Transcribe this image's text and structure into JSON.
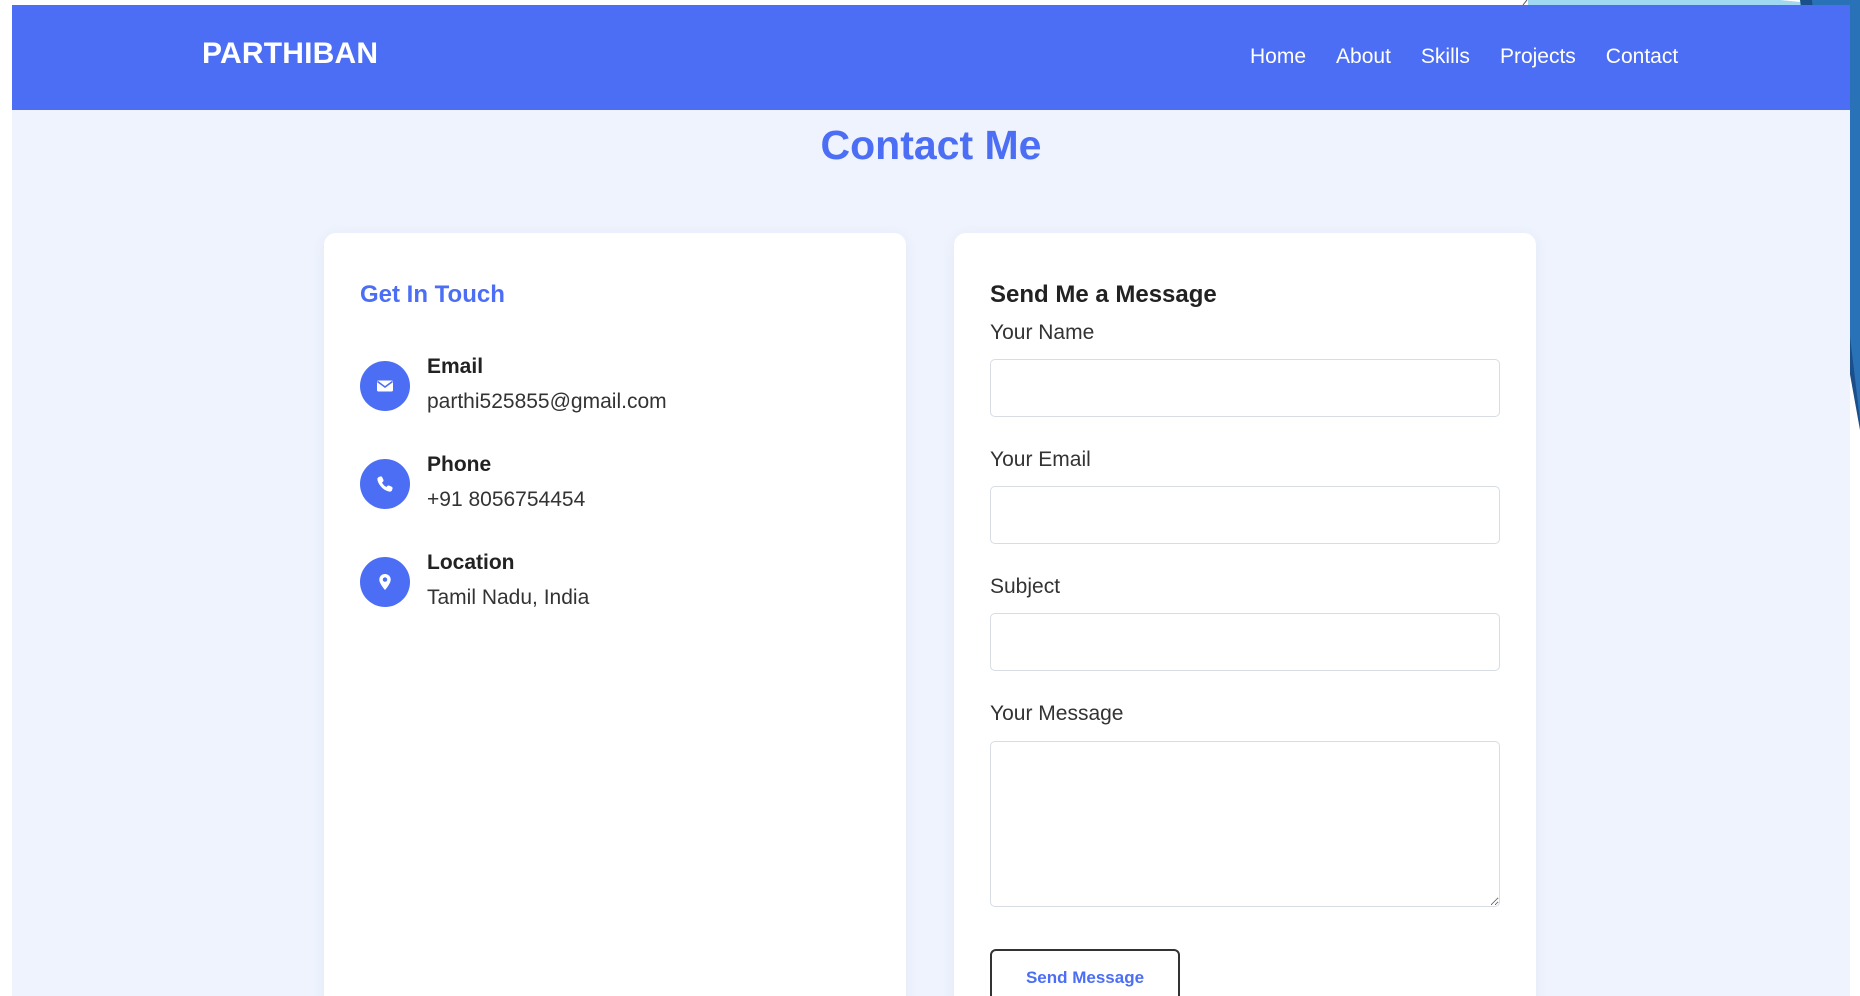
{
  "nav": {
    "brand": "PARTHIBAN",
    "links": [
      "Home",
      "About",
      "Skills",
      "Projects",
      "Contact"
    ]
  },
  "page_title": "Contact Me",
  "contact_info": {
    "heading": "Get In Touch",
    "items": [
      {
        "label": "Email",
        "value": "parthi525855@gmail.com",
        "icon": "envelope-icon"
      },
      {
        "label": "Phone",
        "value": "+91 8056754454",
        "icon": "phone-icon"
      },
      {
        "label": "Location",
        "value": "Tamil Nadu, India",
        "icon": "map-pin-icon"
      }
    ]
  },
  "form": {
    "heading": "Send Me a Message",
    "fields": [
      {
        "label": "Your Name",
        "value": "",
        "placeholder": ""
      },
      {
        "label": "Your Email",
        "value": "",
        "placeholder": ""
      },
      {
        "label": "Subject",
        "value": "",
        "placeholder": ""
      },
      {
        "label": "Your Message",
        "value": "",
        "placeholder": ""
      }
    ],
    "submit_label": "Send Message"
  },
  "colors": {
    "accent": "#4c6ef5",
    "page_background": "#eef3fd",
    "card_background": "#ffffff"
  }
}
